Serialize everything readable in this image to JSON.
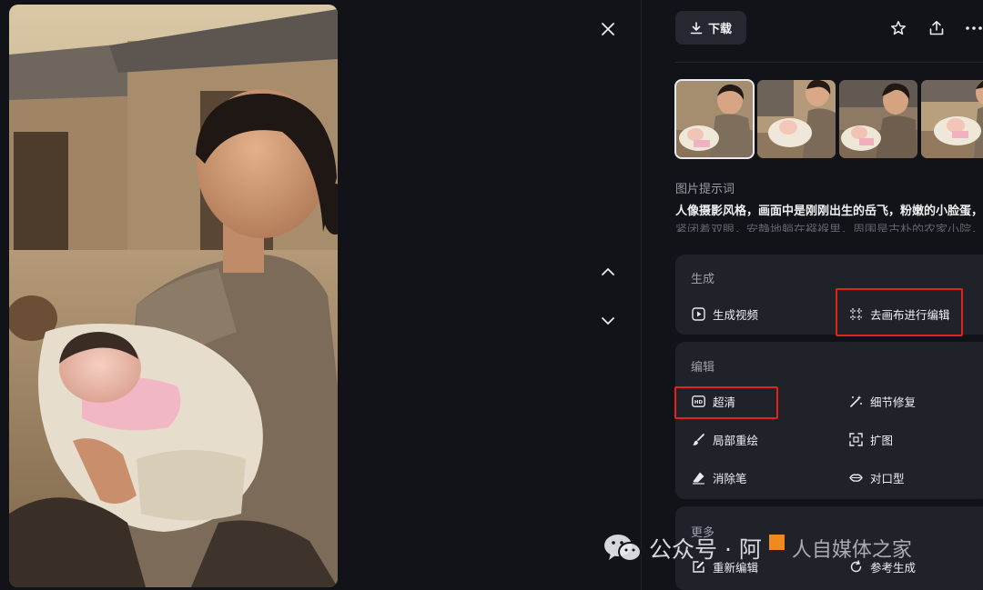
{
  "toolbar": {
    "download_label": "下载"
  },
  "prompt": {
    "heading": "图片提示词",
    "line1": "人像摄影风格，画面中是刚刚出生的岳飞，粉嫩的小脸蛋，",
    "line2": "紧闭着双眼，安静地躺在襁褓里，周围是古朴的农家小院，"
  },
  "generate": {
    "title": "生成",
    "video_label": "生成视频",
    "canvas_label": "去画布进行编辑"
  },
  "edit": {
    "title": "编辑",
    "hd_label": "超清",
    "detail_label": "细节修复",
    "inpaint_label": "局部重绘",
    "expand_label": "扩图",
    "eraser_label": "消除笔",
    "lipsync_label": "对口型"
  },
  "more": {
    "title": "更多",
    "reedit_label": "重新编辑",
    "other_label": "参考生成"
  },
  "watermark": {
    "text_a": "公众号 · 阿",
    "text_b": "人自媒体之家"
  },
  "colors": {
    "highlight": "#e0241b",
    "panel_bg": "#121318",
    "card_bg": "#1f2229"
  },
  "icons": [
    "close-icon",
    "chevron-up-icon",
    "chevron-down-icon",
    "download-icon",
    "star-icon",
    "share-icon",
    "more-icon",
    "play-icon",
    "canvas-icon",
    "hd-icon",
    "magic-wand-icon",
    "brush-icon",
    "expand-icon",
    "eraser-icon",
    "lips-icon",
    "edit-icon",
    "wechat-icon"
  ]
}
